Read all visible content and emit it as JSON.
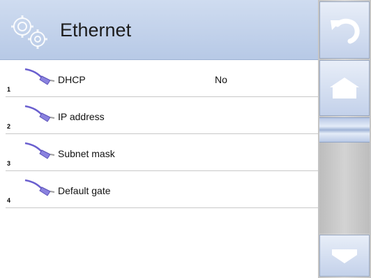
{
  "header": {
    "title": "Ethernet",
    "icon": "gear-icon"
  },
  "items": [
    {
      "number": "1",
      "label": "DHCP",
      "value": "No",
      "icon": "network-cable-icon"
    },
    {
      "number": "2",
      "label": "IP address",
      "value": "",
      "icon": "network-cable-icon"
    },
    {
      "number": "3",
      "label": "Subnet mask",
      "value": "",
      "icon": "network-cable-icon"
    },
    {
      "number": "4",
      "label": "Default gate",
      "value": "",
      "icon": "network-cable-icon"
    }
  ],
  "sidebar": {
    "back_icon": "back-arrow-icon",
    "home_icon": "home-icon",
    "down_icon": "arrow-down-icon"
  },
  "colors": {
    "header_bg": "#b7c9e6",
    "accent": "#7b6fd6",
    "sidebar_bg": "#c4c4c4"
  }
}
